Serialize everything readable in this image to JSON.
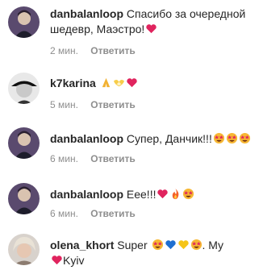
{
  "comments": [
    {
      "username": "danbalanloop",
      "text": "Спасибо за очередной шедевр, Маэстро!",
      "emojis": [
        "red-heart"
      ],
      "time": "2 мин.",
      "reply_label": "Ответить"
    },
    {
      "username": "k7karina",
      "text": "",
      "emojis": [
        "folded-hands",
        "heart-hands",
        "red-heart"
      ],
      "time": "5 мин.",
      "reply_label": "Ответить"
    },
    {
      "username": "danbalanloop",
      "text": "Супер, Данчик!!!",
      "emojis": [
        "star-struck",
        "star-struck",
        "star-struck"
      ],
      "time": "6 мин.",
      "reply_label": "Ответить"
    },
    {
      "username": "danbalanloop",
      "text": "Еее!!!",
      "emojis": [
        "red-heart",
        "fire",
        "star-struck"
      ],
      "time": "6 мин.",
      "reply_label": "Ответить"
    },
    {
      "username": "olena_khort",
      "text_parts": [
        "Super",
        ". My",
        "Kyiv"
      ],
      "emojis": [
        "star-struck",
        "blue-heart",
        "yellow-heart",
        "star-struck",
        "red-heart"
      ],
      "time": "",
      "reply_label": ""
    }
  ],
  "colors": {
    "text": "#262626",
    "meta": "#8e8e8e",
    "heart_red": "#e0245e",
    "heart_blue": "#1f6fd1",
    "heart_yellow": "#f5c518"
  }
}
